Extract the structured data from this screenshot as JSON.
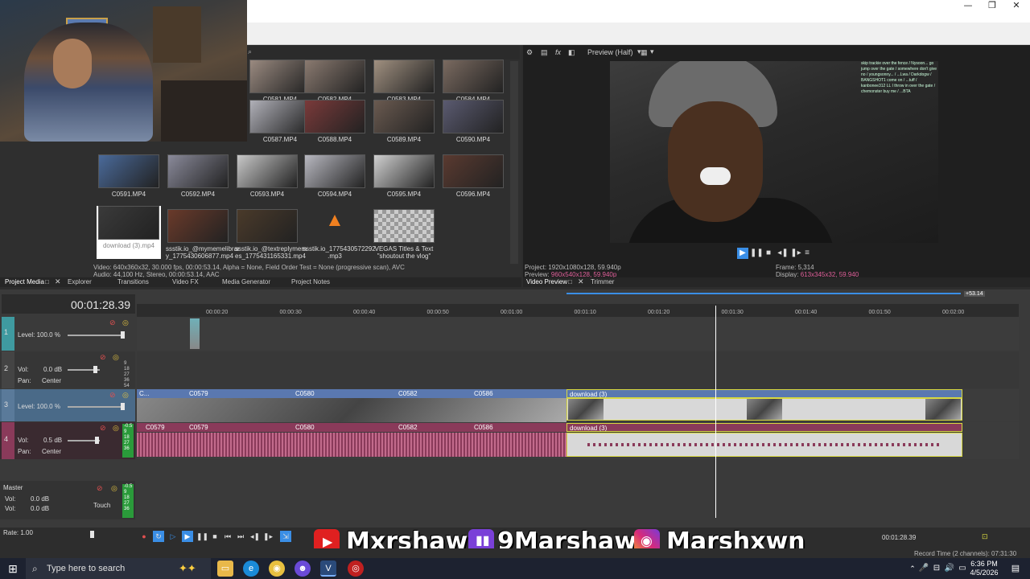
{
  "window": {
    "minimize": "—",
    "restore": "❐",
    "close": "✕"
  },
  "media": {
    "thumbs": [
      {
        "cap": "C0581.MP4",
        "color": "#9a8a80"
      },
      {
        "cap": "C0582.MP4",
        "color": "#8a7a70"
      },
      {
        "cap": "C0583.MP4",
        "color": "#a09080"
      },
      {
        "cap": "C0584.MP4",
        "color": "#7a6a60"
      },
      {
        "cap": "C0587.MP4",
        "color": "#b0b0b8"
      },
      {
        "cap": "C0588.MP4",
        "color": "#7a3a3a"
      },
      {
        "cap": "C0589.MP4",
        "color": "#6a5a50"
      },
      {
        "cap": "C0590.MP4",
        "color": "#5a5a70"
      },
      {
        "cap": "C0591.MP4",
        "color": "#4a6a9a"
      },
      {
        "cap": "C0592.MP4",
        "color": "#8a8a9a"
      },
      {
        "cap": "C0593.MP4",
        "color": "#c8c8c8"
      },
      {
        "cap": "C0594.MP4",
        "color": "#b8b8c0"
      },
      {
        "cap": "C0595.MP4",
        "color": "#d0d0d0"
      },
      {
        "cap": "C0596.MP4",
        "color": "#5a3a30"
      },
      {
        "cap": "download (3).mp4",
        "color": "#3a3a3a"
      },
      {
        "cap": "ssstik.io_@mymemelibrar y_1775430606877.mp4",
        "color": "#6a3a2a"
      },
      {
        "cap": "ssstik.io_@textreplymem es_1775431165331.mp4",
        "color": "#4a3a2a"
      },
      {
        "cap": "ssstik.io_1775430572292 .mp3",
        "color": "#2f2f2f"
      },
      {
        "cap": "VEGAS Titles & Text \"shoutout the vlog\"",
        "color": "#bdbdbd"
      }
    ],
    "info_line1": "Video: 640x360x32, 30.000 fps, 00:00:53.14, Alpha = None, Field Order Test = None (progressive scan), AVC",
    "info_line2": "Audio: 44,100 Hz, Stereo, 00:00:53.14, AAC",
    "tabs": [
      "Project Media",
      "Explorer",
      "Transitions",
      "Video FX",
      "Media Generator",
      "Project Notes"
    ]
  },
  "preview": {
    "mode": "Preview (Half)",
    "project_label": "Project:",
    "project_value": "1920x1080x128, 59.940p",
    "preview_label": "Preview:",
    "preview_value": "960x540x128, 59.940p",
    "frame_label": "Frame:",
    "frame_value": "5,314",
    "display_label": "Display:",
    "display_value": "613x345x32, 59.940",
    "chat": "skip trackie over the fence / Nysoon... go jump over the gate / somewhere don't give no / youngsonny... / ...Lwa / Darkdogw / BANGSHOT1 come on / ...tuff / kanbonee312 LL I throw in over the gate / chemonster buy me / ...BTA",
    "tabs": [
      "Video Preview",
      "Trimmer"
    ]
  },
  "timeline": {
    "time": "00:01:28.39",
    "end_marker": "+53.14",
    "ruler": [
      "00:00:20",
      "00:00:30",
      "00:00:40",
      "00:00:50",
      "00:01:00",
      "00:01:10",
      "00:01:20",
      "00:01:30",
      "00:01:40",
      "00:01:50",
      "00:02:00"
    ],
    "tracks": {
      "t1": {
        "num": "1",
        "level": "Level: 100.0 %"
      },
      "t2": {
        "num": "2",
        "vol": "Vol:",
        "vol_val": "0.0 dB",
        "pan": "Pan:",
        "pan_val": "Center",
        "meter": "9\n18\n27\n36\n54"
      },
      "t3": {
        "num": "3",
        "level": "Level: 100.0 %"
      },
      "t4": {
        "num": "4",
        "vol": "Vol:",
        "vol_val": "0.5 dB",
        "pan": "Pan:",
        "pan_val": "Center",
        "meter": "-0.5\n9\n18\n27\n36"
      }
    },
    "video_clips": [
      "C...",
      "C0579",
      "C0580",
      "C0582",
      "C0586",
      "download (3)"
    ],
    "audio_clips": [
      "C0579",
      "C0579",
      "C0580",
      "C0582",
      "C0586",
      "download (3)"
    ],
    "master": {
      "label": "Master",
      "vol1": "Vol:",
      "vol1_val": "0.0 dB",
      "vol2": "Vol:",
      "vol2_val": "0.0 dB",
      "touch": "Touch",
      "meter": "-0.5\n9\n18\n27\n36"
    },
    "rate": "Rate: 1.00",
    "cursor_time": "00:01:28.39",
    "record_time": "Record Time (2 channels): 07:31:30"
  },
  "overlay": {
    "youtube": "Mxrshawn",
    "twitch": "9Marshawn",
    "instagram": "Marshxwn"
  },
  "taskbar": {
    "search": "Type here to search",
    "time": "6:36 PM",
    "date": "4/5/2026"
  }
}
